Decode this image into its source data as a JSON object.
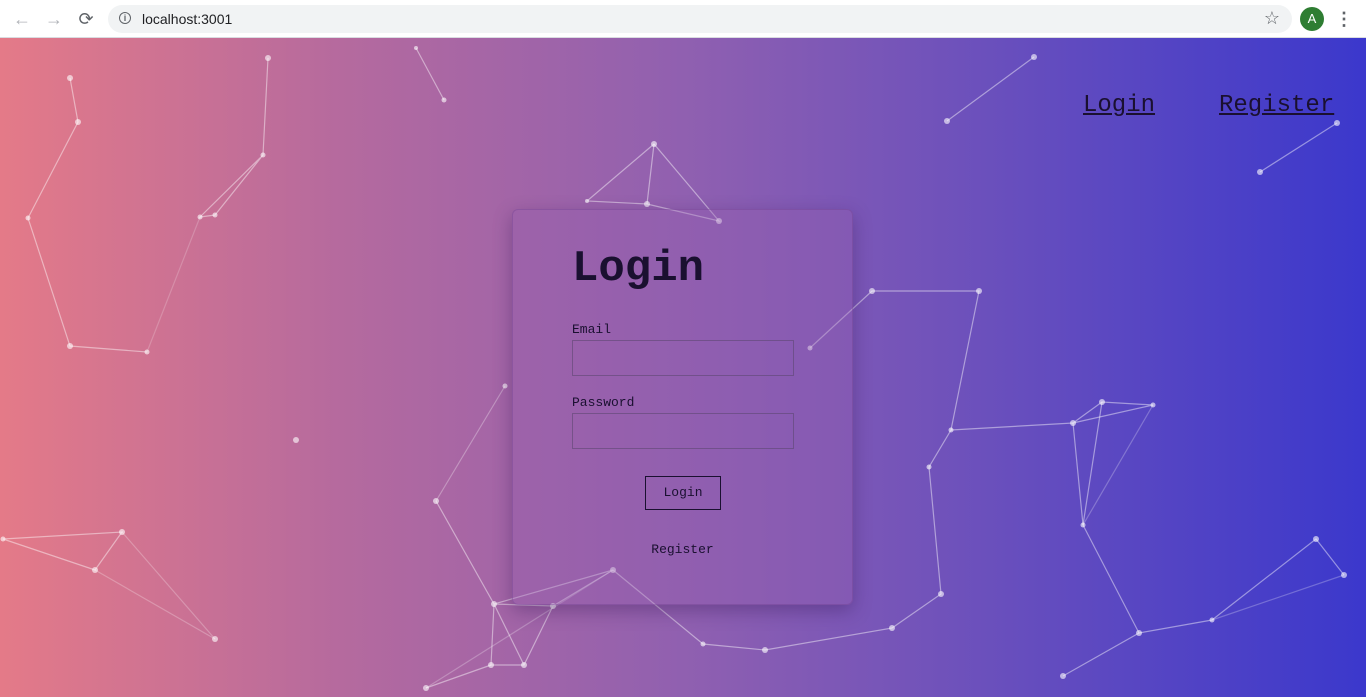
{
  "browser": {
    "back_icon": "arrow-left-icon",
    "forward_icon": "arrow-right-icon",
    "reload_icon": "reload-icon",
    "info_icon": "info-icon",
    "url": "localhost:3001",
    "star_icon": "star-icon",
    "avatar_letter": "A",
    "avatar_color": "#2e7d32",
    "menu_icon": "kebab-menu-icon"
  },
  "nav": {
    "login": "Login",
    "register": "Register"
  },
  "login_form": {
    "title": "Login",
    "email_label": "Email",
    "email_value": "",
    "password_label": "Password",
    "password_value": "",
    "submit_label": "Login",
    "register_link": "Register"
  },
  "colors": {
    "gradient_start": "#e47a88",
    "gradient_end": "#3b38cc",
    "text": "#1a1030"
  }
}
